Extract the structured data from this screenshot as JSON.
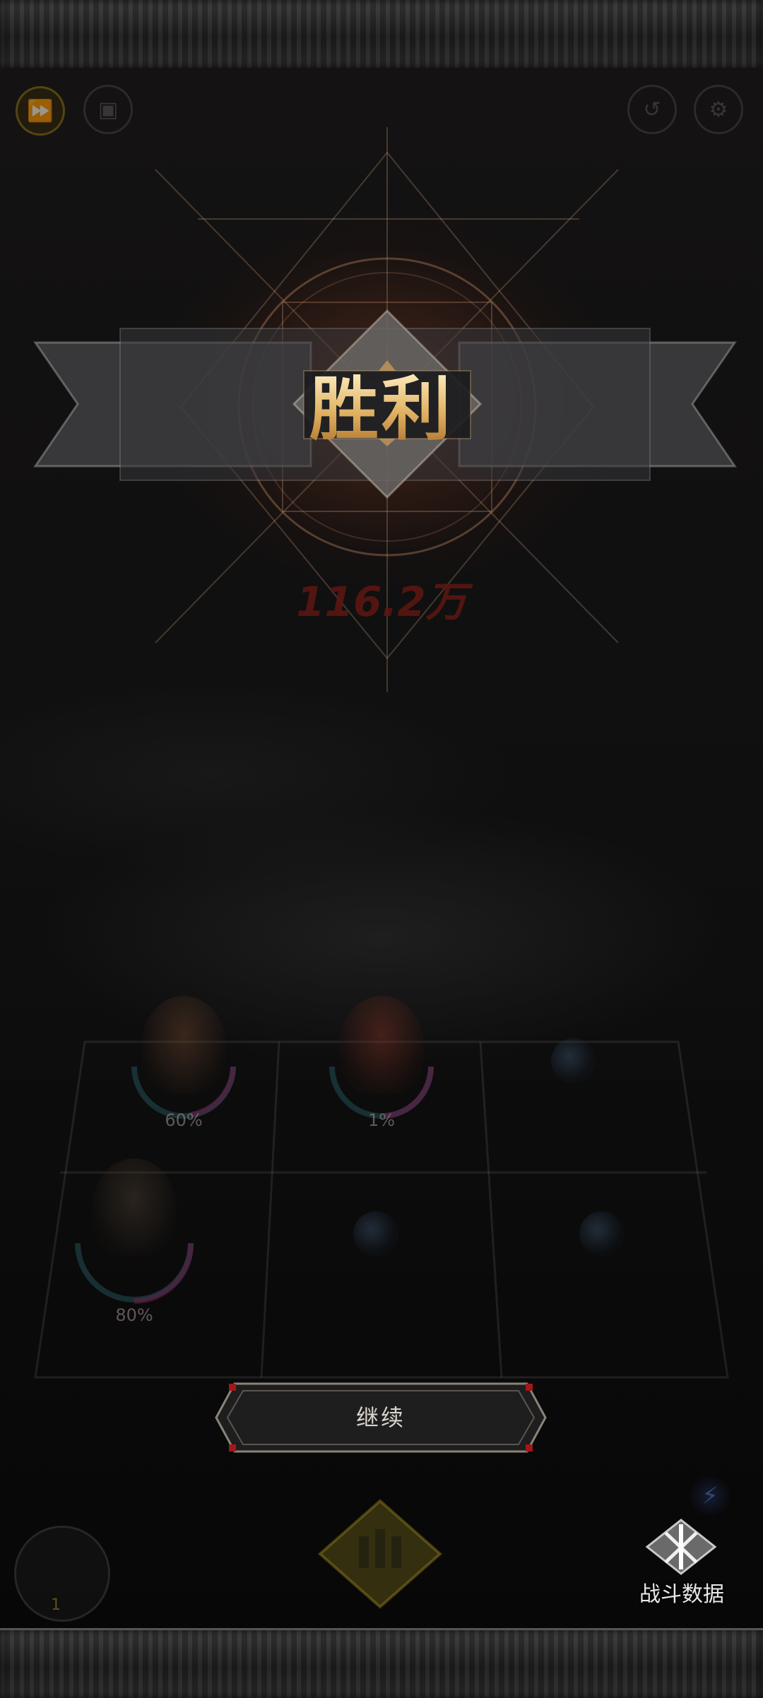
{
  "top_bar": {
    "icons": [
      "speed-icon",
      "record-icon",
      "exit-icon",
      "settings-icon"
    ]
  },
  "result": {
    "title": "胜利",
    "damage_text": "116.2万"
  },
  "heroes": [
    {
      "hp": "60%"
    },
    {
      "hp": "1%"
    },
    {
      "hp": "80%"
    }
  ],
  "actions": {
    "continue_label": "继续",
    "battle_data_label": "战斗数据"
  },
  "bottom_hud": {
    "count": "1"
  },
  "colors": {
    "title_gold": "#e0b060",
    "background": "#0b0b0b",
    "damage_red": "#5f1612"
  }
}
